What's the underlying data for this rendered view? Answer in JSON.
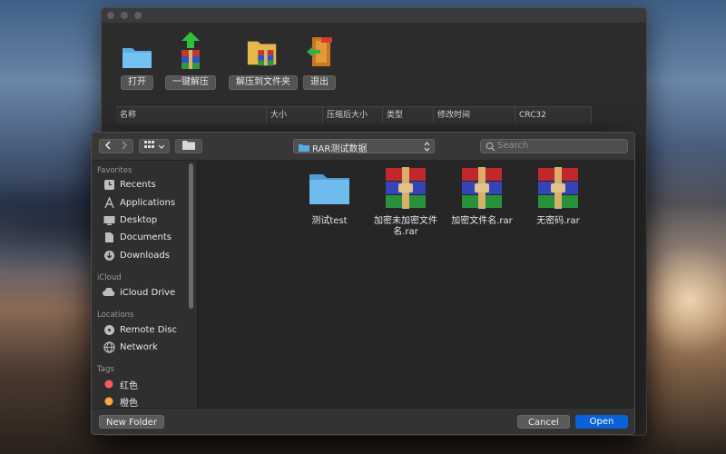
{
  "app": {
    "toolbar": [
      {
        "label": "打开",
        "icon": "folder-icon"
      },
      {
        "label": "一键解压",
        "icon": "extract-icon"
      },
      {
        "label": "解压到文件夹",
        "icon": "extract-to-folder-icon"
      },
      {
        "label": "退出",
        "icon": "exit-icon"
      }
    ],
    "columns": [
      "名称",
      "大小",
      "压缩后大小",
      "类型",
      "修改时间",
      "CRC32"
    ]
  },
  "dialog": {
    "path": "RAR测试数据",
    "search_placeholder": "Search",
    "sidebar": {
      "favorites_header": "Favorites",
      "favorites": [
        {
          "label": "Recents",
          "icon": "clock-icon"
        },
        {
          "label": "Applications",
          "icon": "applications-icon"
        },
        {
          "label": "Desktop",
          "icon": "desktop-icon"
        },
        {
          "label": "Documents",
          "icon": "documents-icon"
        },
        {
          "label": "Downloads",
          "icon": "downloads-icon"
        }
      ],
      "icloud_header": "iCloud",
      "icloud": [
        {
          "label": "iCloud Drive",
          "icon": "cloud-icon"
        }
      ],
      "locations_header": "Locations",
      "locations": [
        {
          "label": "Remote Disc",
          "icon": "disc-icon"
        },
        {
          "label": "Network",
          "icon": "globe-icon"
        }
      ],
      "tags_header": "Tags",
      "tags": [
        {
          "label": "红色",
          "color": "#ff5b5b"
        },
        {
          "label": "橙色",
          "color": "#ffa53a"
        }
      ]
    },
    "files": [
      {
        "name": "测试test",
        "type": "folder"
      },
      {
        "name": "加密未加密文件名.rar",
        "type": "rar"
      },
      {
        "name": "加密文件名.rar",
        "type": "rar"
      },
      {
        "name": "无密码.rar",
        "type": "rar"
      }
    ],
    "buttons": {
      "new_folder": "New Folder",
      "cancel": "Cancel",
      "open": "Open"
    },
    "accent": "#0a62d8"
  }
}
